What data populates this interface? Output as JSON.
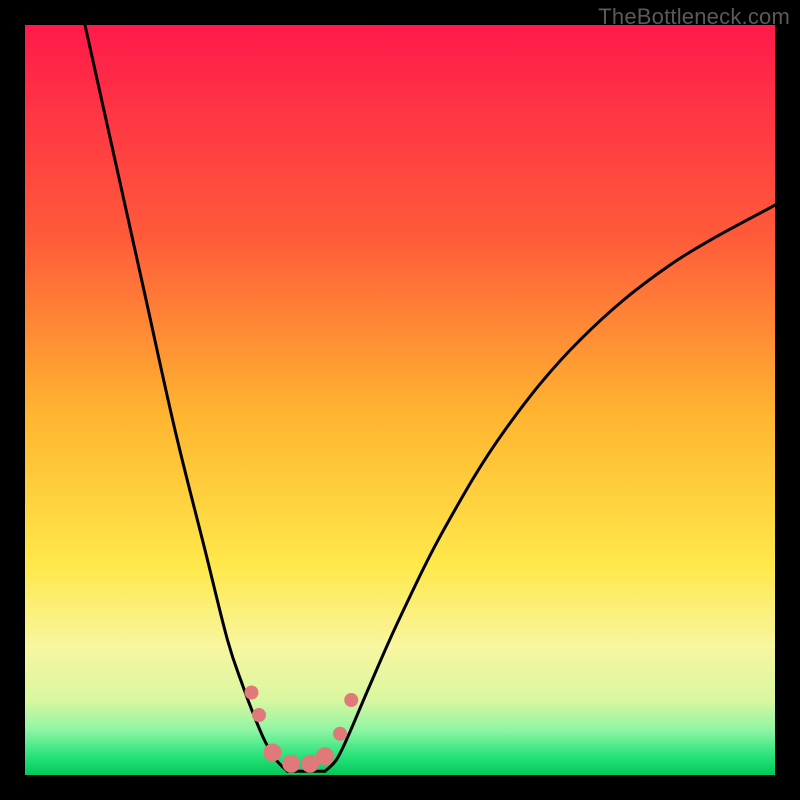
{
  "attribution": "TheBottleneck.com",
  "chart_data": {
    "type": "line",
    "title": "",
    "xlabel": "",
    "ylabel": "",
    "x_range": [
      0,
      100
    ],
    "y_range": [
      0,
      100
    ],
    "gradient_stops": [
      {
        "pos": 0.0,
        "color": "#ff1a4b"
      },
      {
        "pos": 0.28,
        "color": "#ff5a3a"
      },
      {
        "pos": 0.52,
        "color": "#ffb530"
      },
      {
        "pos": 0.72,
        "color": "#ffe84a"
      },
      {
        "pos": 0.83,
        "color": "#f8f6a0"
      },
      {
        "pos": 0.9,
        "color": "#d9f7a0"
      },
      {
        "pos": 0.94,
        "color": "#8ff5a3"
      },
      {
        "pos": 0.975,
        "color": "#26e37a"
      },
      {
        "pos": 1.0,
        "color": "#05c759"
      }
    ],
    "series": [
      {
        "name": "curve-left",
        "points": [
          {
            "x": 8.0,
            "y": 100.0
          },
          {
            "x": 12.0,
            "y": 82.0
          },
          {
            "x": 16.0,
            "y": 64.0
          },
          {
            "x": 20.0,
            "y": 46.0
          },
          {
            "x": 24.0,
            "y": 30.0
          },
          {
            "x": 27.0,
            "y": 18.0
          },
          {
            "x": 29.0,
            "y": 12.0
          },
          {
            "x": 30.5,
            "y": 8.0
          },
          {
            "x": 32.0,
            "y": 4.5
          },
          {
            "x": 33.5,
            "y": 2.0
          },
          {
            "x": 35.0,
            "y": 0.5
          }
        ]
      },
      {
        "name": "valley-floor",
        "points": [
          {
            "x": 35.0,
            "y": 0.5
          },
          {
            "x": 40.0,
            "y": 0.5
          }
        ]
      },
      {
        "name": "curve-right",
        "points": [
          {
            "x": 40.0,
            "y": 0.5
          },
          {
            "x": 41.5,
            "y": 2.0
          },
          {
            "x": 43.0,
            "y": 5.0
          },
          {
            "x": 46.0,
            "y": 12.0
          },
          {
            "x": 50.0,
            "y": 21.0
          },
          {
            "x": 56.0,
            "y": 33.0
          },
          {
            "x": 64.0,
            "y": 46.0
          },
          {
            "x": 74.0,
            "y": 58.0
          },
          {
            "x": 86.0,
            "y": 68.0
          },
          {
            "x": 100.0,
            "y": 76.0
          }
        ]
      }
    ],
    "markers": {
      "name": "valley-markers",
      "color": "#e07a7a",
      "points": [
        {
          "x": 30.2,
          "y": 11.0,
          "r": 7
        },
        {
          "x": 31.2,
          "y": 8.0,
          "r": 7
        },
        {
          "x": 33.0,
          "y": 3.0,
          "r": 9
        },
        {
          "x": 35.5,
          "y": 1.5,
          "r": 9
        },
        {
          "x": 38.0,
          "y": 1.5,
          "r": 9
        },
        {
          "x": 40.0,
          "y": 2.5,
          "r": 9
        },
        {
          "x": 42.0,
          "y": 5.5,
          "r": 7
        },
        {
          "x": 43.5,
          "y": 10.0,
          "r": 7
        }
      ]
    }
  }
}
